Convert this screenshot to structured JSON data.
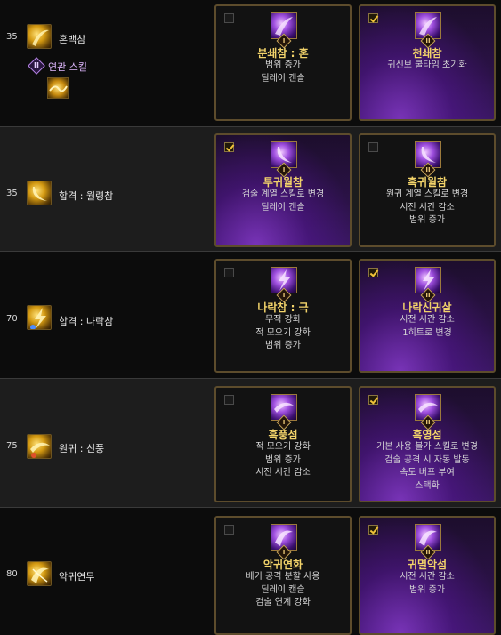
{
  "colors": {
    "card_border": "#5d4c2c",
    "talent_name": "#f2d36a",
    "selected_purple": "#6a2ab0",
    "related_label": "#e0b8ff"
  },
  "rows": [
    {
      "level": "35",
      "skill_name": "혼백참",
      "skill_icon": "golden-slash-icon",
      "related": {
        "badge": "II",
        "label": "연관 스킬",
        "icon": "golden-wave-icon"
      },
      "talents": [
        {
          "checked": false,
          "badge": "I",
          "icon": "purple-slash-icon",
          "name": "분쇄참 : 혼",
          "desc": [
            "범위 증가",
            "딜레이 캔슬"
          ]
        },
        {
          "checked": true,
          "badge": "II",
          "icon": "purple-slash-icon",
          "name": "천쇄참",
          "desc": [
            "귀신보 쿨타임 초기화"
          ]
        }
      ]
    },
    {
      "level": "35",
      "skill_name": "합격 : 월령참",
      "skill_icon": "golden-crescent-icon",
      "talents": [
        {
          "checked": true,
          "badge": "I",
          "icon": "purple-crescent-icon",
          "name": "투귀월참",
          "desc": [
            "검술 계열 스킬로 변경",
            "딜레이 캔슬"
          ]
        },
        {
          "checked": false,
          "badge": "II",
          "icon": "purple-crescent-icon",
          "name": "흑귀월참",
          "desc": [
            "원귀 계열 스킬로 변경",
            "시전 시간 감소",
            "범위 증가"
          ]
        }
      ]
    },
    {
      "level": "70",
      "skill_name": "합격 : 나락참",
      "skill_icon": "golden-lightning-icon",
      "talents": [
        {
          "checked": false,
          "badge": "I",
          "icon": "purple-lightning-icon",
          "name": "나락참 : 극",
          "desc": [
            "무적 강화",
            "적 모으기 강화",
            "범위 증가"
          ]
        },
        {
          "checked": true,
          "badge": "II",
          "icon": "purple-lightning-icon",
          "name": "나락신귀살",
          "desc": [
            "시전 시간 감소",
            "1히트로 변경"
          ]
        }
      ]
    },
    {
      "level": "75",
      "skill_name": "원귀 : 신풍",
      "skill_icon": "golden-wind-icon",
      "talents": [
        {
          "checked": false,
          "badge": "I",
          "icon": "purple-wind-icon",
          "name": "흑풍섬",
          "desc": [
            "적 모으기 강화",
            "범위 증가",
            "시전 시간 감소"
          ]
        },
        {
          "checked": true,
          "badge": "II",
          "icon": "purple-wind-icon",
          "name": "흑영섬",
          "desc": [
            "기본 사용 불가 스킬로 변경",
            "검술 공격 시 자동 발동",
            "속도 버프 부여",
            "스택화"
          ]
        }
      ]
    },
    {
      "level": "80",
      "skill_name": "악귀연무",
      "skill_icon": "golden-dance-icon",
      "talents": [
        {
          "checked": false,
          "badge": "I",
          "icon": "purple-dance-icon",
          "name": "악귀연화",
          "desc": [
            "베기 공격 분할 사용",
            "딜레이 캔슬",
            "검술 연계 강화"
          ]
        },
        {
          "checked": true,
          "badge": "II",
          "icon": "purple-dance-icon",
          "name": "귀멸악섬",
          "desc": [
            "시전 시간 감소",
            "범위 증가"
          ]
        }
      ]
    }
  ]
}
